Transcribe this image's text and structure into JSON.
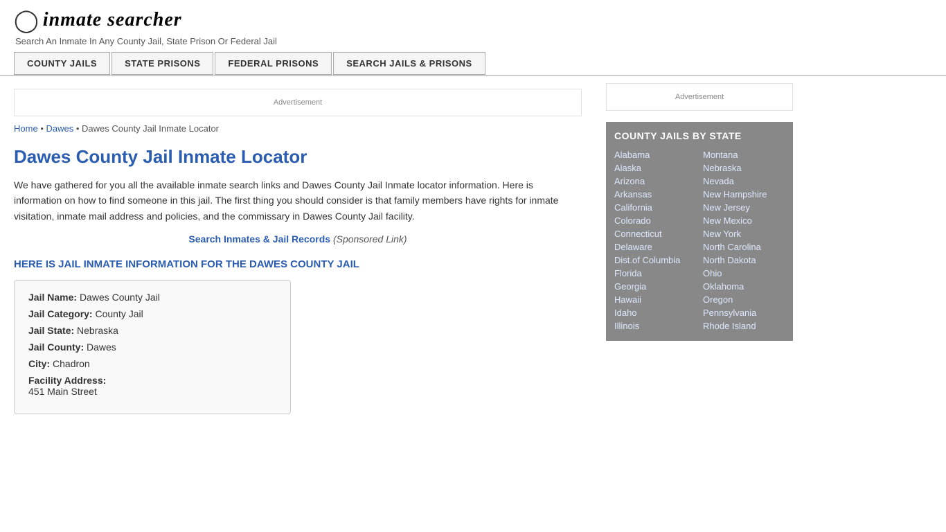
{
  "header": {
    "logo_icon": "🔍",
    "logo_text": "inmate searcher",
    "tagline": "Search An Inmate In Any County Jail, State Prison Or Federal Jail"
  },
  "nav": {
    "items": [
      {
        "label": "COUNTY JAILS",
        "id": "county-jails"
      },
      {
        "label": "STATE PRISONS",
        "id": "state-prisons"
      },
      {
        "label": "FEDERAL PRISONS",
        "id": "federal-prisons"
      },
      {
        "label": "SEARCH JAILS & PRISONS",
        "id": "search-jails"
      }
    ]
  },
  "ad_banner": {
    "label": "Advertisement"
  },
  "breadcrumb": {
    "home": "Home",
    "dawes": "Dawes",
    "current": "Dawes County Jail Inmate Locator"
  },
  "page_title": "Dawes County Jail Inmate Locator",
  "description": "We have gathered for you all the available inmate search links and Dawes County Jail Inmate locator information. Here is information on how to find someone in this jail. The first thing you should consider is that family members have rights for inmate visitation, inmate mail address and policies, and the commissary in Dawes County Jail facility.",
  "sponsored": {
    "link_text": "Search Inmates & Jail Records",
    "label": "(Sponsored Link)"
  },
  "infobox_heading": "HERE IS JAIL INMATE INFORMATION FOR THE DAWES COUNTY JAIL",
  "jail_info": {
    "name_label": "Jail Name:",
    "name_value": "Dawes County Jail",
    "category_label": "Jail Category:",
    "category_value": "County Jail",
    "state_label": "Jail State:",
    "state_value": "Nebraska",
    "county_label": "Jail County:",
    "county_value": "Dawes",
    "city_label": "City:",
    "city_value": "Chadron",
    "address_label": "Facility Address:",
    "address_value": "451 Main Street"
  },
  "sidebar": {
    "ad_label": "Advertisement",
    "state_box_title": "COUNTY JAILS BY STATE",
    "left_states": [
      "Alabama",
      "Alaska",
      "Arizona",
      "Arkansas",
      "California",
      "Colorado",
      "Connecticut",
      "Delaware",
      "Dist.of Columbia",
      "Florida",
      "Georgia",
      "Hawaii",
      "Idaho",
      "Illinois"
    ],
    "right_states": [
      "Montana",
      "Nebraska",
      "Nevada",
      "New Hampshire",
      "New Jersey",
      "New Mexico",
      "New York",
      "North Carolina",
      "North Dakota",
      "Ohio",
      "Oklahoma",
      "Oregon",
      "Pennsylvania",
      "Rhode Island"
    ]
  }
}
